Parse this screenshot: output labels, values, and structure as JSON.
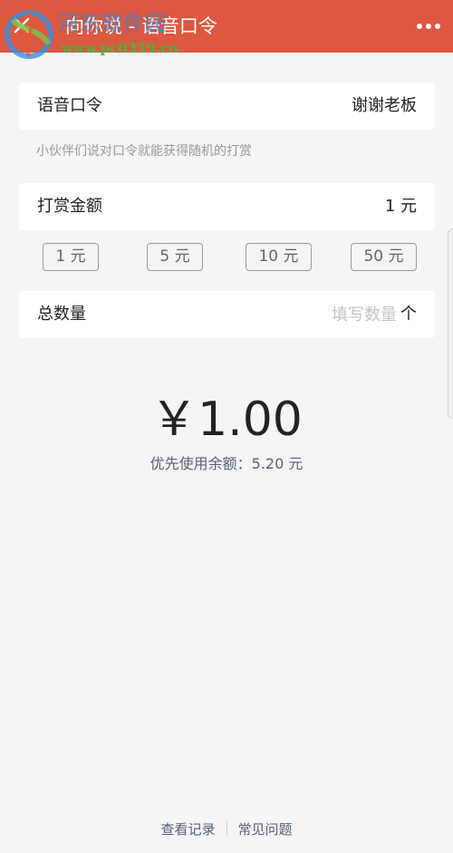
{
  "header": {
    "title": "向你说 - 语音口令",
    "close_icon": "close-icon",
    "more_icon": "more-dots-icon",
    "bg_color": "#dd5840"
  },
  "watermark": {
    "cn_text": "河东软件园",
    "url_text": "www.pc0359.cn"
  },
  "command": {
    "label": "语音口令",
    "value": "谢谢老板"
  },
  "hint": "小伙伴们说对口令就能获得随机的打赏",
  "amount": {
    "label": "打赏金额",
    "value": "1 元",
    "chips": [
      "1 元",
      "5 元",
      "10 元",
      "50 元"
    ]
  },
  "count": {
    "label": "总数量",
    "placeholder": "填写数量",
    "value": "",
    "unit": "个"
  },
  "total": "￥1.00",
  "balance_text": "优先使用余额：5.20 元",
  "footer": {
    "records": "查看记录",
    "faq": "常见问题"
  }
}
